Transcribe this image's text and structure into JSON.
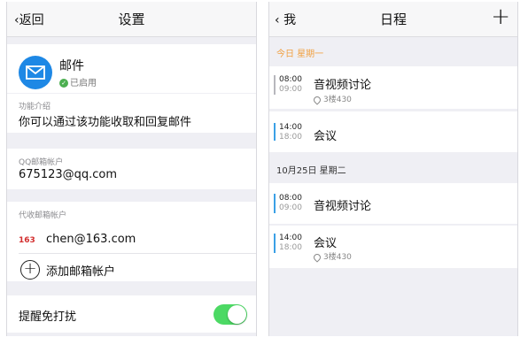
{
  "settings": {
    "nav": {
      "back_label": "返回",
      "title": "设置"
    },
    "mail": {
      "title": "邮件",
      "status": "已启用",
      "accent_color": "#1e88e5"
    },
    "feature": {
      "label": "功能介绍",
      "description": "你可以通过该功能收取和回复邮件"
    },
    "qq_mailbox": {
      "label": "QQ邮箱帐户",
      "value": "675123@qq.com"
    },
    "proxy_mailbox": {
      "label": "代收邮箱帐户",
      "provider_logo": "163",
      "account": "chen@163.com",
      "add_label": "添加邮箱帐户"
    },
    "dnd": {
      "label": "提醒免打扰",
      "enabled": true,
      "toggle_color": "#4cd964"
    }
  },
  "schedule": {
    "nav": {
      "back_label": "我",
      "title": "日程",
      "add_icon": "plus-icon"
    },
    "days": [
      {
        "label": "今日  星期一",
        "highlight_color": "#f0a040",
        "events": [
          {
            "start": "08:00",
            "end": "09:00",
            "title": "音视频讨论",
            "location": "3楼430",
            "bar": "grey"
          },
          {
            "start": "14:00",
            "end": "18:00",
            "title": "会议",
            "location": "",
            "bar": "blue"
          }
        ]
      },
      {
        "label": "10月25日  星期二",
        "events": [
          {
            "start": "08:00",
            "end": "09:00",
            "title": "音视频讨论",
            "location": "",
            "bar": "blue"
          },
          {
            "start": "14:00",
            "end": "18:00",
            "title": "会议",
            "location": "3楼430",
            "bar": "blue"
          }
        ]
      }
    ]
  }
}
